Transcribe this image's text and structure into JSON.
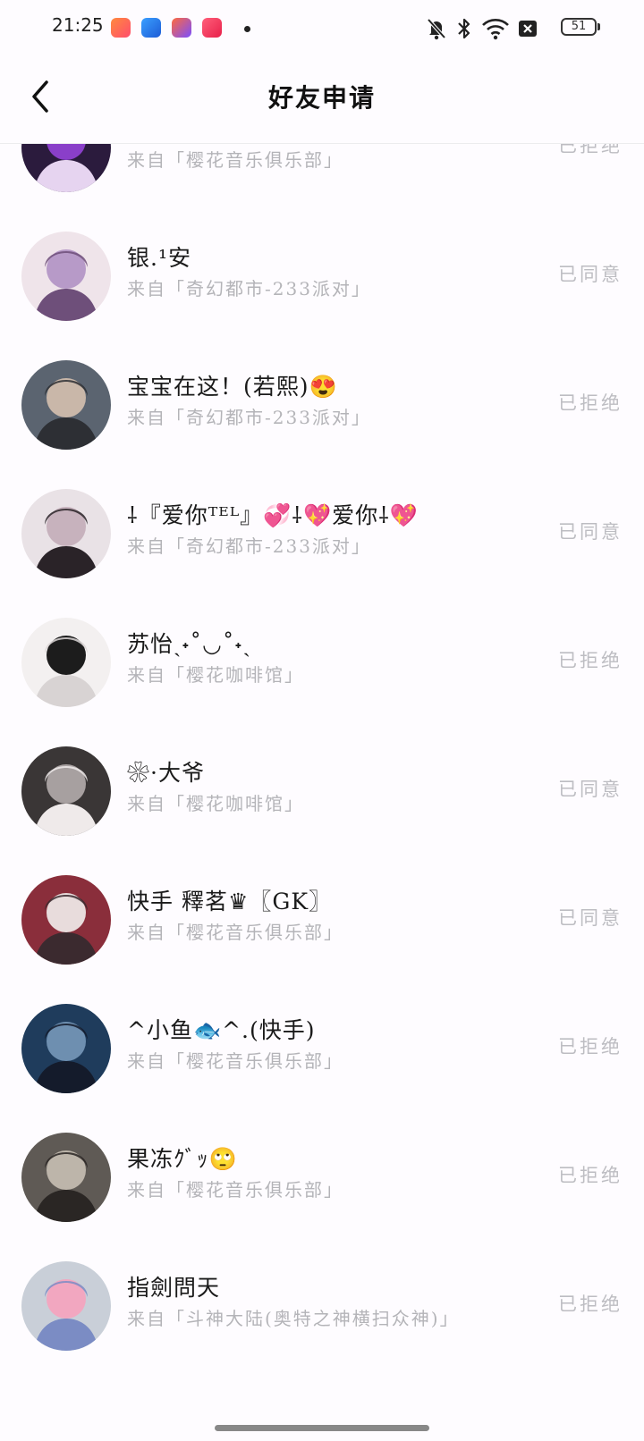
{
  "status_bar": {
    "time": "21:25",
    "battery": "51",
    "icons": [
      "app-icon-1",
      "app-icon-2",
      "app-icon-3",
      "music-app-icon",
      "notification-dot",
      "mute-bell-icon",
      "bluetooth-icon",
      "wifi-icon",
      "sim-x-icon",
      "battery-icon"
    ]
  },
  "nav": {
    "title": "好友申请",
    "back_icon": "chevron-left-icon"
  },
  "requests": [
    {
      "name": "",
      "source": "来自「樱花音乐俱乐部」",
      "status": "已拒绝"
    },
    {
      "name": "银.¹安",
      "source": "来自「奇幻都市-233派对」",
      "status": "已同意"
    },
    {
      "name": "宝宝在这！(若熙)😍",
      "source": "来自「奇幻都市-233派对」",
      "status": "已拒绝"
    },
    {
      "name": "⸸『爱你ᵀᴱᴸ』💞⸸💖爱你⸸💖",
      "source": "来自「奇幻都市-233派对」",
      "status": "已同意"
    },
    {
      "name": "苏怡ˏ˖˚◡˚˖ˎ",
      "source": "来自「樱花咖啡馆」",
      "status": "已拒绝"
    },
    {
      "name": "❀·大爷",
      "source": "来自「樱花咖啡馆」",
      "status": "已同意"
    },
    {
      "name": "快手 釋茗♛〖GK〗",
      "source": "来自「樱花音乐俱乐部」",
      "status": "已同意"
    },
    {
      "name": "^小鱼🐟^.(快手)",
      "source": "来自「樱花音乐俱乐部」",
      "status": "已拒绝"
    },
    {
      "name": "果冻ｸﾞｯ🙄",
      "source": "来自「樱花音乐俱乐部」",
      "status": "已拒绝"
    },
    {
      "name": "指劍問天",
      "source": "来自「斗神大陆(奥特之神横扫众神)」",
      "status": "已拒绝"
    }
  ],
  "colors": {
    "background": "#fefcff",
    "name_text": "#1a1a1a",
    "source_text": "#b4b4b8",
    "status_text": "#bdbdc2"
  }
}
